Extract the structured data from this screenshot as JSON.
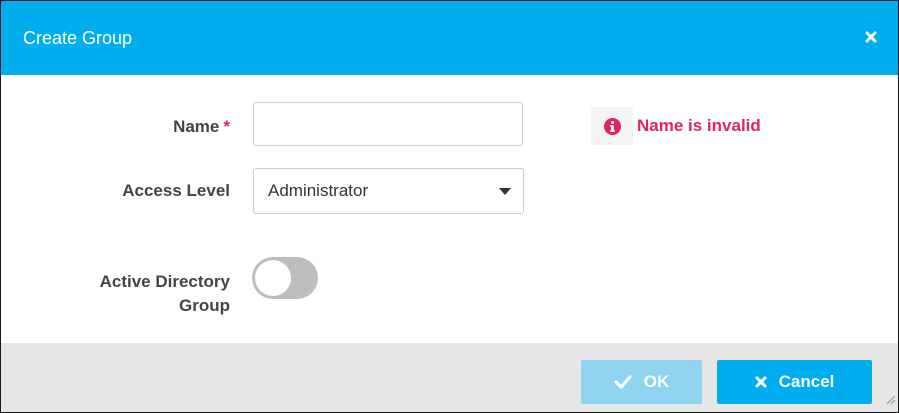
{
  "dialog": {
    "title": "Create Group",
    "close_icon": "close-icon"
  },
  "form": {
    "name": {
      "label": "Name",
      "required_marker": "*",
      "value": "",
      "error": "Name is invalid",
      "error_icon": "info-circle-icon"
    },
    "access_level": {
      "label": "Access Level",
      "selected": "Administrator",
      "icon": "caret-down-icon"
    },
    "active_directory": {
      "label_line1": "Active Directory",
      "label_line2": "Group",
      "enabled": false
    }
  },
  "footer": {
    "ok_label": "OK",
    "ok_icon": "check-icon",
    "cancel_label": "Cancel",
    "cancel_icon": "close-icon"
  },
  "colors": {
    "header": "#00aeef",
    "error": "#e0245e",
    "ok_disabled": "#8fd4f1",
    "footer": "#e6e6e6"
  }
}
